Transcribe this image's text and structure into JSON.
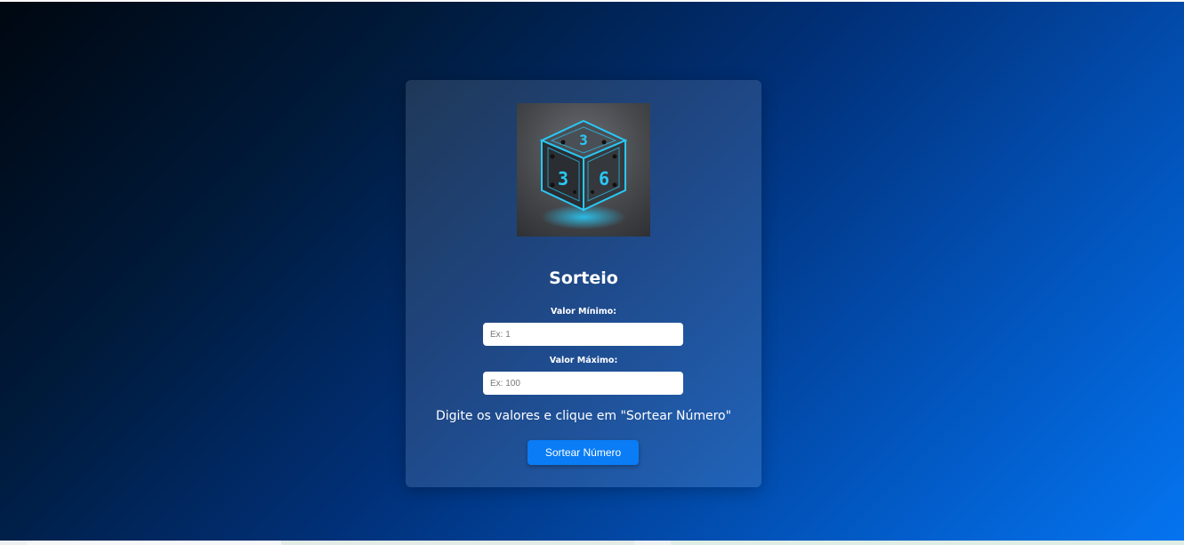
{
  "card": {
    "image_icon": "dice-icon",
    "dice_top_digit": "3",
    "dice_left_digit": "3",
    "dice_right_digit": "6",
    "title": "Sorteio",
    "min_label": "Valor Mínimo:",
    "min_placeholder": "Ex: 1",
    "min_value": "",
    "max_label": "Valor Máximo:",
    "max_placeholder": "Ex: 100",
    "max_value": "",
    "message": "Digite os valores e clique em \"Sortear Número\"",
    "button_label": "Sortear Número"
  },
  "colors": {
    "background_start": "#000710",
    "background_end": "#0474f0",
    "button": "#0a7cf5",
    "dice_glow": "#29c8f5"
  }
}
